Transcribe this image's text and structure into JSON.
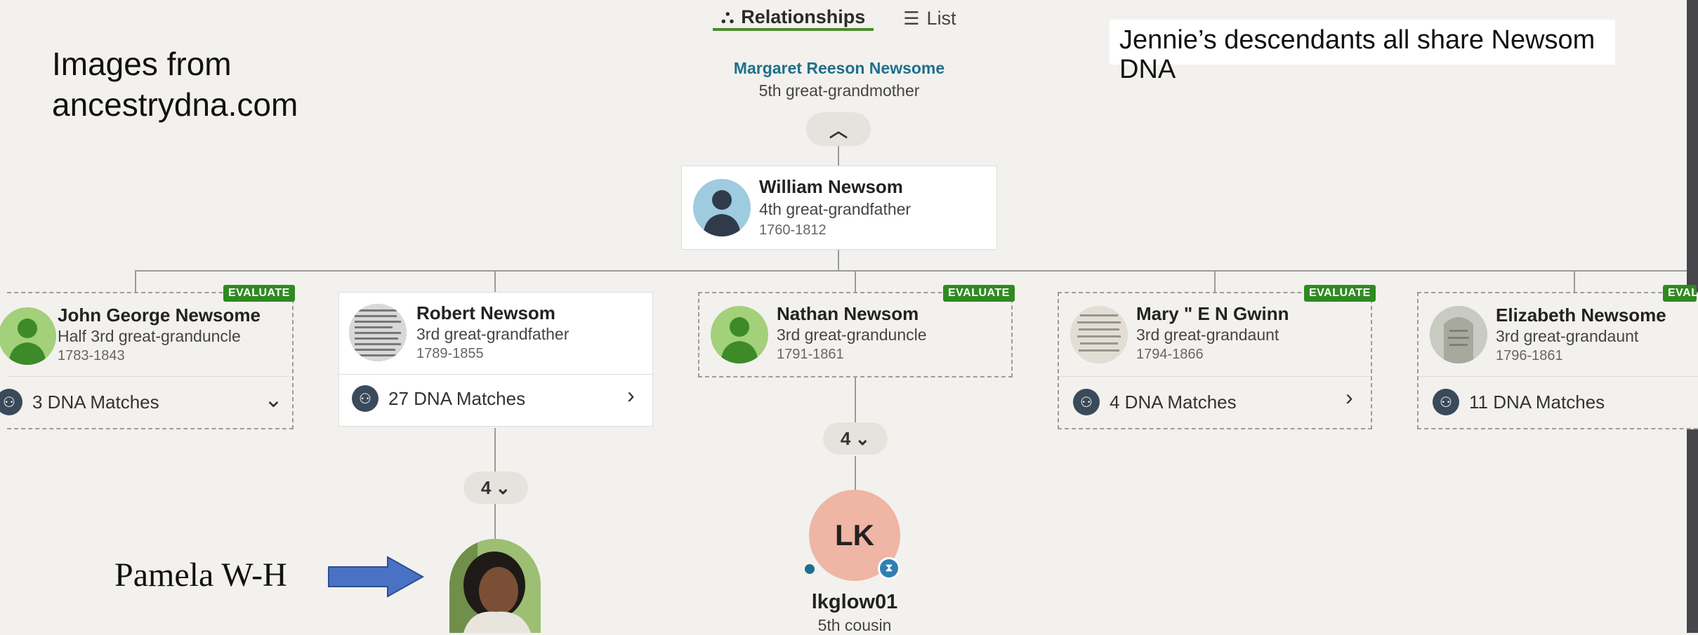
{
  "caption": {
    "line1": "Images from",
    "line2": "ancestrydna.com"
  },
  "note": "Jennie’s descendants all share Newsom DNA",
  "tabs": [
    {
      "label": "Relationships",
      "icon": "network-icon"
    },
    {
      "label": "List",
      "icon": "list-icon"
    }
  ],
  "root": {
    "name": "Margaret Reeson Newsome",
    "relation": "5th great-grandmother"
  },
  "parent": {
    "name": "William Newsom",
    "relation": "4th great-grandfather",
    "years": "1760-1812"
  },
  "badge_label": "EVALUATE",
  "children": [
    {
      "name": "John George Newsome",
      "relation": "Half 3rd great-granduncle",
      "years": "1783-1843",
      "matches": "3 DNA Matches"
    },
    {
      "name": "Robert Newsom",
      "relation": "3rd great-grandfather",
      "years": "1789-1855",
      "matches": "27 DNA Matches"
    },
    {
      "name": "Nathan Newsom",
      "relation": "3rd great-granduncle",
      "years": "1791-1861"
    },
    {
      "name": "Mary \" E N Gwinn",
      "relation": "3rd great-grandaunt",
      "years": "1794-1866",
      "matches": "4 DNA Matches"
    },
    {
      "name": "Elizabeth Newsome",
      "relation": "3rd great-grandaunt",
      "years": "1796-1861",
      "matches": "11 DNA Matches"
    }
  ],
  "counts": {
    "robert": "4",
    "nathan": "4"
  },
  "descendant": {
    "initials": "LK",
    "name": "lkglow01",
    "relation": "5th cousin"
  },
  "pamela_label": "Pamela W-H",
  "colors": {
    "accent_green": "#4a8b2c",
    "badge_green": "#2f8a21",
    "root_link": "#1f6f8b",
    "lk_avatar": "#efb5a5",
    "arrow": "#4a72c4"
  }
}
